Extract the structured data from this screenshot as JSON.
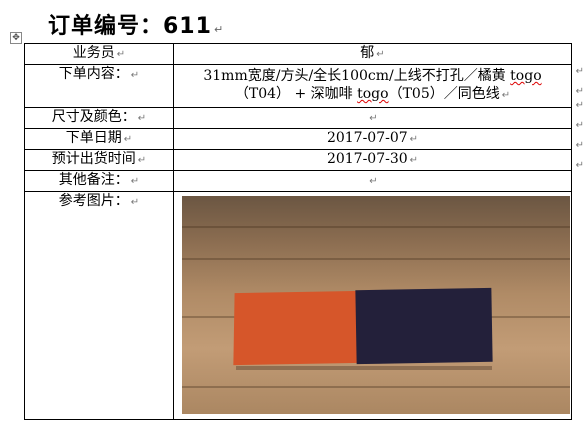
{
  "title": "订单编号：611",
  "paragraph_mark": "↵",
  "rows": {
    "salesperson_label": "业务员",
    "salesperson_value": "郁",
    "content_label": "下单内容：",
    "content_line1_a": "31mm宽度/方头/全长100cm/上线不打孔／橘黄",
    "content_line1_b": "togo",
    "content_line2_a": "（T04） + 深咖啡",
    "content_line2_b": "togo",
    "content_line2_c": "（T05）／同色线",
    "size_color_label": "尺寸及颜色：",
    "order_date_label": "下单日期",
    "order_date_value": "2017-07-07",
    "ship_date_label": "预计出货时间",
    "ship_date_value": "2017-07-30",
    "remarks_label": "其他备注：",
    "reference_label": "参考图片："
  },
  "icons": {
    "table_move": "move-icon"
  },
  "colors": {
    "swatch_orange": "#d6562a",
    "swatch_navy": "#23203a",
    "spell_underline": "#d00000"
  }
}
